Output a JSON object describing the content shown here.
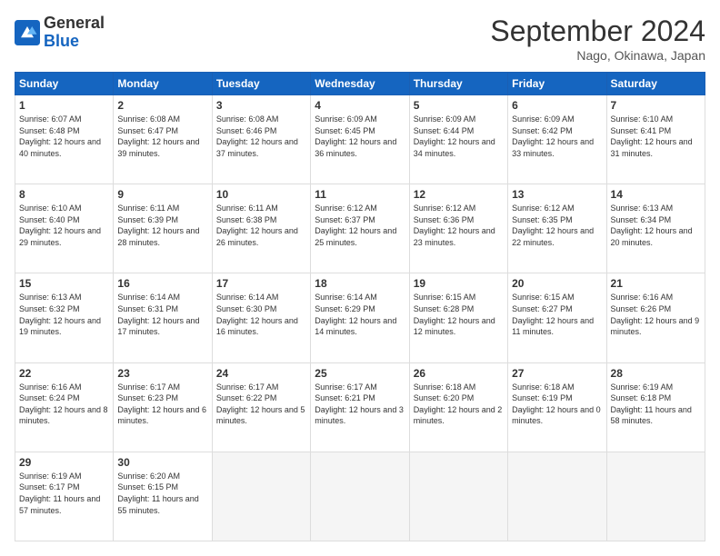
{
  "logo": {
    "general": "General",
    "blue": "Blue"
  },
  "header": {
    "month": "September 2024",
    "location": "Nago, Okinawa, Japan"
  },
  "days_of_week": [
    "Sunday",
    "Monday",
    "Tuesday",
    "Wednesday",
    "Thursday",
    "Friday",
    "Saturday"
  ],
  "weeks": [
    [
      {
        "day": "1",
        "sunrise": "6:07 AM",
        "sunset": "6:48 PM",
        "daylight": "12 hours and 40 minutes."
      },
      {
        "day": "2",
        "sunrise": "6:08 AM",
        "sunset": "6:47 PM",
        "daylight": "12 hours and 39 minutes."
      },
      {
        "day": "3",
        "sunrise": "6:08 AM",
        "sunset": "6:46 PM",
        "daylight": "12 hours and 37 minutes."
      },
      {
        "day": "4",
        "sunrise": "6:09 AM",
        "sunset": "6:45 PM",
        "daylight": "12 hours and 36 minutes."
      },
      {
        "day": "5",
        "sunrise": "6:09 AM",
        "sunset": "6:44 PM",
        "daylight": "12 hours and 34 minutes."
      },
      {
        "day": "6",
        "sunrise": "6:09 AM",
        "sunset": "6:42 PM",
        "daylight": "12 hours and 33 minutes."
      },
      {
        "day": "7",
        "sunrise": "6:10 AM",
        "sunset": "6:41 PM",
        "daylight": "12 hours and 31 minutes."
      }
    ],
    [
      {
        "day": "8",
        "sunrise": "6:10 AM",
        "sunset": "6:40 PM",
        "daylight": "12 hours and 29 minutes."
      },
      {
        "day": "9",
        "sunrise": "6:11 AM",
        "sunset": "6:39 PM",
        "daylight": "12 hours and 28 minutes."
      },
      {
        "day": "10",
        "sunrise": "6:11 AM",
        "sunset": "6:38 PM",
        "daylight": "12 hours and 26 minutes."
      },
      {
        "day": "11",
        "sunrise": "6:12 AM",
        "sunset": "6:37 PM",
        "daylight": "12 hours and 25 minutes."
      },
      {
        "day": "12",
        "sunrise": "6:12 AM",
        "sunset": "6:36 PM",
        "daylight": "12 hours and 23 minutes."
      },
      {
        "day": "13",
        "sunrise": "6:12 AM",
        "sunset": "6:35 PM",
        "daylight": "12 hours and 22 minutes."
      },
      {
        "day": "14",
        "sunrise": "6:13 AM",
        "sunset": "6:34 PM",
        "daylight": "12 hours and 20 minutes."
      }
    ],
    [
      {
        "day": "15",
        "sunrise": "6:13 AM",
        "sunset": "6:32 PM",
        "daylight": "12 hours and 19 minutes."
      },
      {
        "day": "16",
        "sunrise": "6:14 AM",
        "sunset": "6:31 PM",
        "daylight": "12 hours and 17 minutes."
      },
      {
        "day": "17",
        "sunrise": "6:14 AM",
        "sunset": "6:30 PM",
        "daylight": "12 hours and 16 minutes."
      },
      {
        "day": "18",
        "sunrise": "6:14 AM",
        "sunset": "6:29 PM",
        "daylight": "12 hours and 14 minutes."
      },
      {
        "day": "19",
        "sunrise": "6:15 AM",
        "sunset": "6:28 PM",
        "daylight": "12 hours and 12 minutes."
      },
      {
        "day": "20",
        "sunrise": "6:15 AM",
        "sunset": "6:27 PM",
        "daylight": "12 hours and 11 minutes."
      },
      {
        "day": "21",
        "sunrise": "6:16 AM",
        "sunset": "6:26 PM",
        "daylight": "12 hours and 9 minutes."
      }
    ],
    [
      {
        "day": "22",
        "sunrise": "6:16 AM",
        "sunset": "6:24 PM",
        "daylight": "12 hours and 8 minutes."
      },
      {
        "day": "23",
        "sunrise": "6:17 AM",
        "sunset": "6:23 PM",
        "daylight": "12 hours and 6 minutes."
      },
      {
        "day": "24",
        "sunrise": "6:17 AM",
        "sunset": "6:22 PM",
        "daylight": "12 hours and 5 minutes."
      },
      {
        "day": "25",
        "sunrise": "6:17 AM",
        "sunset": "6:21 PM",
        "daylight": "12 hours and 3 minutes."
      },
      {
        "day": "26",
        "sunrise": "6:18 AM",
        "sunset": "6:20 PM",
        "daylight": "12 hours and 2 minutes."
      },
      {
        "day": "27",
        "sunrise": "6:18 AM",
        "sunset": "6:19 PM",
        "daylight": "12 hours and 0 minutes."
      },
      {
        "day": "28",
        "sunrise": "6:19 AM",
        "sunset": "6:18 PM",
        "daylight": "11 hours and 58 minutes."
      }
    ],
    [
      {
        "day": "29",
        "sunrise": "6:19 AM",
        "sunset": "6:17 PM",
        "daylight": "11 hours and 57 minutes."
      },
      {
        "day": "30",
        "sunrise": "6:20 AM",
        "sunset": "6:15 PM",
        "daylight": "11 hours and 55 minutes."
      },
      null,
      null,
      null,
      null,
      null
    ]
  ]
}
